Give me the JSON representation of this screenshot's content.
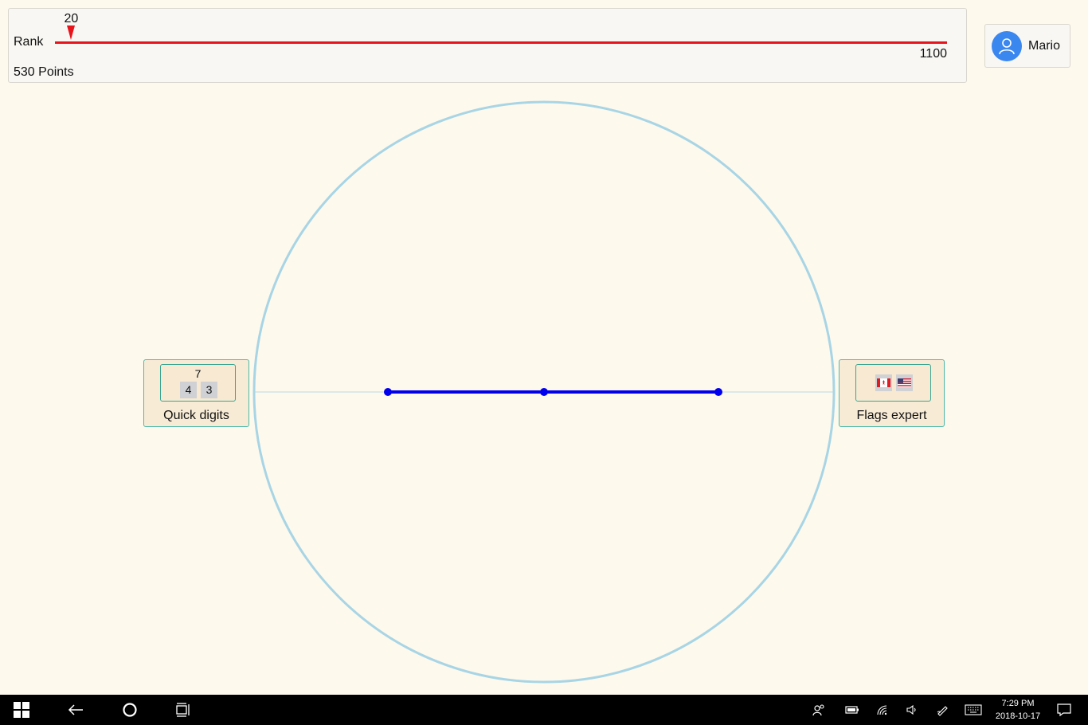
{
  "rank": {
    "label": "Rank",
    "current_rank": "20",
    "max_rank": "1100",
    "current_value": 20,
    "max_value": 1100,
    "points": "530 Points",
    "track_color": "#e8141b"
  },
  "user": {
    "name": "Mario",
    "avatar_icon": "person-icon",
    "avatar_color": "#3b87f0"
  },
  "game": {
    "circle_color": "#a8d5e5",
    "line_color": "#0000ee",
    "cards": {
      "left": {
        "label": "Quick digits",
        "digit_target": "7",
        "digit_a": "4",
        "digit_b": "3"
      },
      "right": {
        "label": "Flags expert",
        "flags": [
          "canada-flag-icon",
          "usa-flag-icon"
        ]
      }
    }
  },
  "taskbar": {
    "icons": [
      "windows-start-icon",
      "back-arrow-icon",
      "cortana-icon",
      "task-view-icon",
      "people-icon",
      "battery-icon",
      "wifi-icon",
      "volume-icon",
      "pen-icon",
      "keyboard-icon",
      "action-center-icon"
    ],
    "time": "7:29 PM",
    "date": "2018-10-17"
  }
}
